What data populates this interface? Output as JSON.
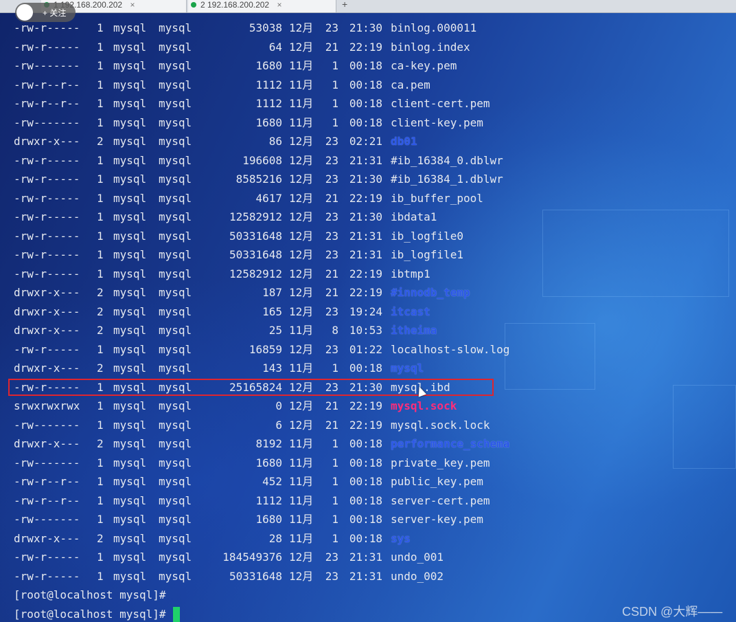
{
  "window": {
    "tabs": [
      {
        "label": "1 192.168.200.202",
        "close": "×",
        "status_color": "#1aa34a"
      },
      {
        "label": "2 192.168.200.202",
        "close": "×",
        "status_color": "#1aa34a"
      }
    ],
    "add_tab": "+"
  },
  "overlay": {
    "avatar_text": "",
    "follow_label": "+ 关注"
  },
  "listing": [
    {
      "perm": "-rw-r-----",
      "links": "1",
      "owner": "mysql",
      "group": "mysql",
      "size": "53038",
      "month": "12月",
      "day": "23",
      "time": "21:30",
      "name": "binlog.000011",
      "kind": "file"
    },
    {
      "perm": "-rw-r-----",
      "links": "1",
      "owner": "mysql",
      "group": "mysql",
      "size": "64",
      "month": "12月",
      "day": "21",
      "time": "22:19",
      "name": "binlog.index",
      "kind": "file"
    },
    {
      "perm": "-rw-------",
      "links": "1",
      "owner": "mysql",
      "group": "mysql",
      "size": "1680",
      "month": "11月",
      "day": "1",
      "time": "00:18",
      "name": "ca-key.pem",
      "kind": "file"
    },
    {
      "perm": "-rw-r--r--",
      "links": "1",
      "owner": "mysql",
      "group": "mysql",
      "size": "1112",
      "month": "11月",
      "day": "1",
      "time": "00:18",
      "name": "ca.pem",
      "kind": "file"
    },
    {
      "perm": "-rw-r--r--",
      "links": "1",
      "owner": "mysql",
      "group": "mysql",
      "size": "1112",
      "month": "11月",
      "day": "1",
      "time": "00:18",
      "name": "client-cert.pem",
      "kind": "file"
    },
    {
      "perm": "-rw-------",
      "links": "1",
      "owner": "mysql",
      "group": "mysql",
      "size": "1680",
      "month": "11月",
      "day": "1",
      "time": "00:18",
      "name": "client-key.pem",
      "kind": "file"
    },
    {
      "perm": "drwxr-x---",
      "links": "2",
      "owner": "mysql",
      "group": "mysql",
      "size": "86",
      "month": "12月",
      "day": "23",
      "time": "02:21",
      "name": "db01",
      "kind": "dir"
    },
    {
      "perm": "-rw-r-----",
      "links": "1",
      "owner": "mysql",
      "group": "mysql",
      "size": "196608",
      "month": "12月",
      "day": "23",
      "time": "21:31",
      "name": "#ib_16384_0.dblwr",
      "kind": "file"
    },
    {
      "perm": "-rw-r-----",
      "links": "1",
      "owner": "mysql",
      "group": "mysql",
      "size": "8585216",
      "month": "12月",
      "day": "23",
      "time": "21:30",
      "name": "#ib_16384_1.dblwr",
      "kind": "file"
    },
    {
      "perm": "-rw-r-----",
      "links": "1",
      "owner": "mysql",
      "group": "mysql",
      "size": "4617",
      "month": "12月",
      "day": "21",
      "time": "22:19",
      "name": "ib_buffer_pool",
      "kind": "file"
    },
    {
      "perm": "-rw-r-----",
      "links": "1",
      "owner": "mysql",
      "group": "mysql",
      "size": "12582912",
      "month": "12月",
      "day": "23",
      "time": "21:30",
      "name": "ibdata1",
      "kind": "file"
    },
    {
      "perm": "-rw-r-----",
      "links": "1",
      "owner": "mysql",
      "group": "mysql",
      "size": "50331648",
      "month": "12月",
      "day": "23",
      "time": "21:31",
      "name": "ib_logfile0",
      "kind": "file"
    },
    {
      "perm": "-rw-r-----",
      "links": "1",
      "owner": "mysql",
      "group": "mysql",
      "size": "50331648",
      "month": "12月",
      "day": "23",
      "time": "21:31",
      "name": "ib_logfile1",
      "kind": "file"
    },
    {
      "perm": "-rw-r-----",
      "links": "1",
      "owner": "mysql",
      "group": "mysql",
      "size": "12582912",
      "month": "12月",
      "day": "21",
      "time": "22:19",
      "name": "ibtmp1",
      "kind": "file"
    },
    {
      "perm": "drwxr-x---",
      "links": "2",
      "owner": "mysql",
      "group": "mysql",
      "size": "187",
      "month": "12月",
      "day": "21",
      "time": "22:19",
      "name": "#innodb_temp",
      "kind": "dir"
    },
    {
      "perm": "drwxr-x---",
      "links": "2",
      "owner": "mysql",
      "group": "mysql",
      "size": "165",
      "month": "12月",
      "day": "23",
      "time": "19:24",
      "name": "itcast",
      "kind": "dir"
    },
    {
      "perm": "drwxr-x---",
      "links": "2",
      "owner": "mysql",
      "group": "mysql",
      "size": "25",
      "month": "11月",
      "day": "8",
      "time": "10:53",
      "name": "itheima",
      "kind": "dir"
    },
    {
      "perm": "-rw-r-----",
      "links": "1",
      "owner": "mysql",
      "group": "mysql",
      "size": "16859",
      "month": "12月",
      "day": "23",
      "time": "01:22",
      "name": "localhost-slow.log",
      "kind": "file"
    },
    {
      "perm": "drwxr-x---",
      "links": "2",
      "owner": "mysql",
      "group": "mysql",
      "size": "143",
      "month": "11月",
      "day": "1",
      "time": "00:18",
      "name": "mysql",
      "kind": "dir"
    },
    {
      "perm": "-rw-r-----",
      "links": "1",
      "owner": "mysql",
      "group": "mysql",
      "size": "25165824",
      "month": "12月",
      "day": "23",
      "time": "21:30",
      "name": "mysql.ibd",
      "kind": "file",
      "highlighted": true
    },
    {
      "perm": "srwxrwxrwx",
      "links": "1",
      "owner": "mysql",
      "group": "mysql",
      "size": "0",
      "month": "12月",
      "day": "21",
      "time": "22:19",
      "name": "mysql.sock",
      "kind": "sock"
    },
    {
      "perm": "-rw-------",
      "links": "1",
      "owner": "mysql",
      "group": "mysql",
      "size": "6",
      "month": "12月",
      "day": "21",
      "time": "22:19",
      "name": "mysql.sock.lock",
      "kind": "file"
    },
    {
      "perm": "drwxr-x---",
      "links": "2",
      "owner": "mysql",
      "group": "mysql",
      "size": "8192",
      "month": "11月",
      "day": "1",
      "time": "00:18",
      "name": "performance_schema",
      "kind": "dir"
    },
    {
      "perm": "-rw-------",
      "links": "1",
      "owner": "mysql",
      "group": "mysql",
      "size": "1680",
      "month": "11月",
      "day": "1",
      "time": "00:18",
      "name": "private_key.pem",
      "kind": "file"
    },
    {
      "perm": "-rw-r--r--",
      "links": "1",
      "owner": "mysql",
      "group": "mysql",
      "size": "452",
      "month": "11月",
      "day": "1",
      "time": "00:18",
      "name": "public_key.pem",
      "kind": "file"
    },
    {
      "perm": "-rw-r--r--",
      "links": "1",
      "owner": "mysql",
      "group": "mysql",
      "size": "1112",
      "month": "11月",
      "day": "1",
      "time": "00:18",
      "name": "server-cert.pem",
      "kind": "file"
    },
    {
      "perm": "-rw-------",
      "links": "1",
      "owner": "mysql",
      "group": "mysql",
      "size": "1680",
      "month": "11月",
      "day": "1",
      "time": "00:18",
      "name": "server-key.pem",
      "kind": "file"
    },
    {
      "perm": "drwxr-x---",
      "links": "2",
      "owner": "mysql",
      "group": "mysql",
      "size": "28",
      "month": "11月",
      "day": "1",
      "time": "00:18",
      "name": "sys",
      "kind": "dir"
    },
    {
      "perm": "-rw-r-----",
      "links": "1",
      "owner": "mysql",
      "group": "mysql",
      "size": "184549376",
      "month": "12月",
      "day": "23",
      "time": "21:31",
      "name": "undo_001",
      "kind": "file"
    },
    {
      "perm": "-rw-r-----",
      "links": "1",
      "owner": "mysql",
      "group": "mysql",
      "size": "50331648",
      "month": "12月",
      "day": "23",
      "time": "21:31",
      "name": "undo_002",
      "kind": "file"
    }
  ],
  "prompts": [
    "[root@localhost mysql]#",
    "[root@localhost mysql]#"
  ],
  "colors": {
    "dir": "#2b57e8",
    "socket": "#ff2d7a",
    "file": "#e6e9ef",
    "highlight_border": "#e0252e",
    "cursor": "#1fd16a"
  },
  "watermark": "CSDN @大辉——"
}
